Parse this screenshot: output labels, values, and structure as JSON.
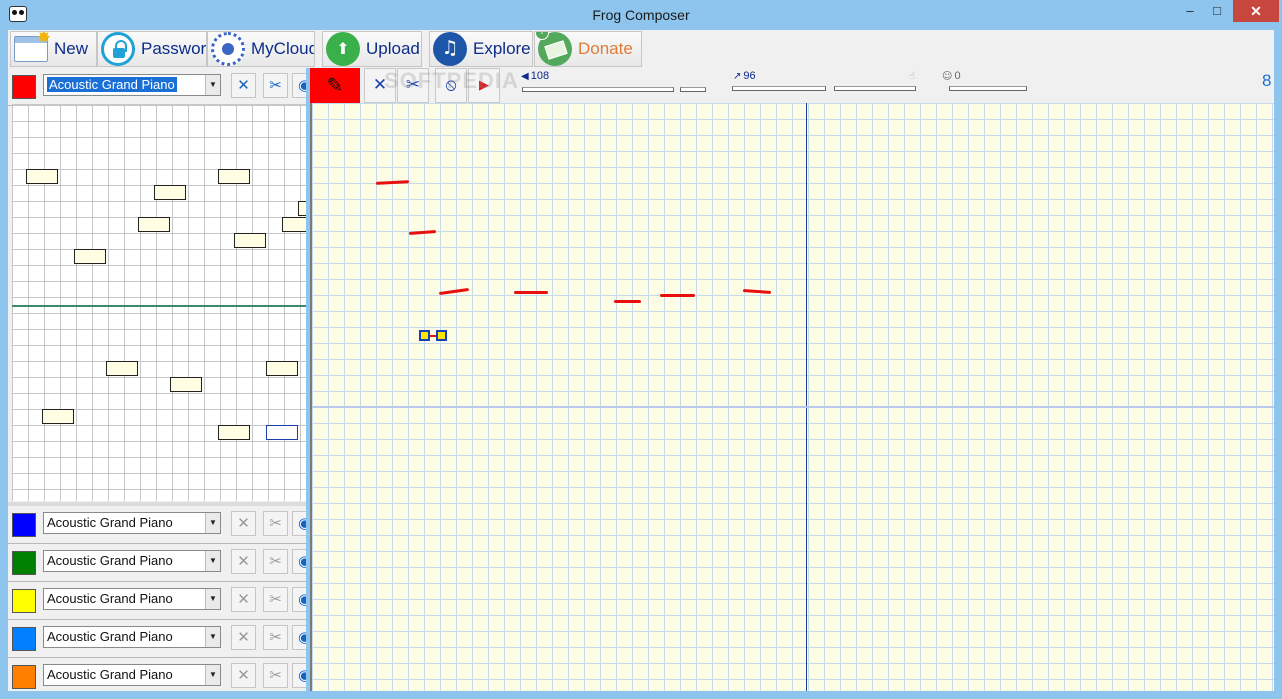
{
  "window": {
    "title": "Frog Composer",
    "minimize_label": "–",
    "maximize_label": "□",
    "close_label": "✕"
  },
  "toolbar": {
    "new_label": "New",
    "password_label": "Password",
    "mycloud_label": "MyCloud",
    "upload_label": "Upload",
    "explore_label": "Explore",
    "donate_label": "Donate"
  },
  "tracks": [
    {
      "color": "#ff0000",
      "instrument": "Acoustic Grand Piano",
      "active": true
    },
    {
      "color": "#0000ff",
      "instrument": "Acoustic Grand Piano",
      "active": false
    },
    {
      "color": "#008000",
      "instrument": "Acoustic Grand Piano",
      "active": false
    },
    {
      "color": "#ffff00",
      "instrument": "Acoustic Grand Piano",
      "active": false
    },
    {
      "color": "#0080ff",
      "instrument": "Acoustic Grand Piano",
      "active": false
    },
    {
      "color": "#ff8000",
      "instrument": "Acoustic Grand Piano",
      "active": false
    }
  ],
  "track_controls": {
    "delete_glyph": "✕",
    "cut_glyph": "✂",
    "eye_glyph": "◉",
    "dropdown_glyph": "▼"
  },
  "editor": {
    "pen_glyph": "✎",
    "delete_glyph": "✕",
    "cut_glyph": "✂",
    "stop_glyph": "⦸",
    "play_glyph": "▶",
    "watermark": "SOFTPEDIA",
    "volume_glyph": "◀",
    "volume_value": "108",
    "velocity_glyph": "↗",
    "velocity_value": "96",
    "hand_glyph": "☝",
    "mood_glyph": "☺",
    "mood_value": "0",
    "beat_count": "8"
  },
  "colors": {
    "accent": "#1a3fb0",
    "stroke": "#e80f0f",
    "grid_bg": "#fdfde6",
    "titlebar": "#8ec5ef"
  }
}
